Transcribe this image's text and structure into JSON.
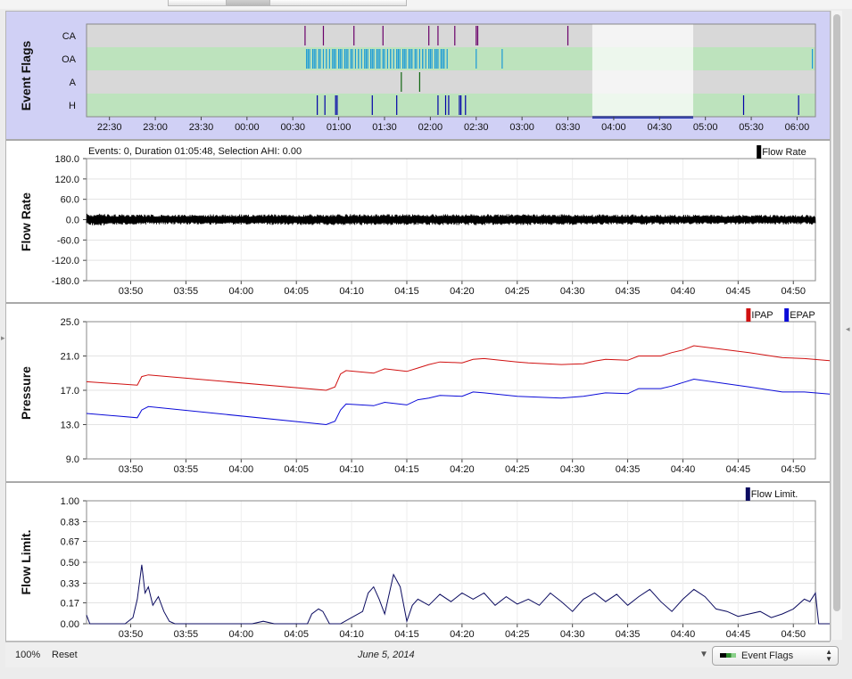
{
  "panels": {
    "event_flags": {
      "title": "Event Flags"
    },
    "flow_rate": {
      "title": "Flow Rate",
      "info": "Events: 0, Duration 01:05:48, Selection AHI: 0.00"
    },
    "pressure": {
      "title": "Pressure"
    },
    "flow_limit": {
      "title": "Flow Limit."
    }
  },
  "footer": {
    "zoom": "100%",
    "reset": "Reset",
    "date": "June 5, 2014",
    "selector": "Event Flags",
    "filter_icon": "funnel-icon"
  },
  "colors": {
    "ipap": "#d01010",
    "epap": "#0a0ad8",
    "flow": "#000000",
    "flowlimit": "#0b0b60",
    "ca_mark": "#6a006a",
    "oa_mark": "#1a9ad6",
    "a_mark": "#116611",
    "h_mark": "#0000a8",
    "event_bg": "#d0d0f5",
    "row_grey": "#d8d8d8",
    "row_green": "#bde3bd"
  },
  "chart_data": [
    {
      "type": "event-timeline",
      "rows": [
        "CA",
        "OA",
        "A",
        "H"
      ],
      "x_ticks": [
        "22:30",
        "23:00",
        "23:30",
        "00:00",
        "00:30",
        "01:00",
        "01:30",
        "02:00",
        "02:30",
        "03:00",
        "03:30",
        "04:00",
        "04:30",
        "05:00",
        "05:30",
        "06:00"
      ],
      "x_range": [
        "22:15",
        "06:12"
      ],
      "selection": [
        "03:46",
        "04:52"
      ],
      "events": {
        "CA": [
          "00:38",
          "00:50",
          "01:10",
          "01:29",
          "01:59",
          "02:05",
          "02:16",
          "02:30",
          "02:31",
          "03:30"
        ],
        "OA": {
          "dense_ranges": [
            [
              "00:39",
              "02:12"
            ]
          ],
          "isolated": [
            "02:30",
            "02:47",
            "06:10"
          ]
        },
        "A": [
          "01:41",
          "01:53"
        ],
        "H": [
          "00:46",
          "00:51",
          "00:58",
          "00:59",
          "01:22",
          "01:38",
          "02:05",
          "02:10",
          "02:12",
          "02:19",
          "02:20",
          "02:23",
          "05:25",
          "06:01"
        ]
      }
    },
    {
      "type": "line",
      "name": "Flow Rate",
      "legend": [
        "Flow Rate"
      ],
      "ylim": [
        -180,
        180
      ],
      "y_ticks": [
        "180.0",
        "120.0",
        "60.0",
        "0.0",
        "-60.0",
        "-120.0",
        "-180.0"
      ],
      "x_range": [
        "03:46",
        "04:52"
      ],
      "x_ticks": [
        "03:50",
        "03:55",
        "04:00",
        "04:05",
        "04:10",
        "04:15",
        "04:20",
        "04:25",
        "04:30",
        "04:35",
        "04:40",
        "04:45",
        "04:50"
      ],
      "envelope": {
        "upper": [
          [
            0,
            18
          ],
          [
            5,
            15
          ],
          [
            20,
            16
          ],
          [
            40,
            16
          ],
          [
            60,
            14
          ],
          [
            70,
            14
          ],
          [
            71,
            58
          ],
          [
            72,
            26
          ],
          [
            80,
            20
          ],
          [
            82,
            18
          ]
        ],
        "lower": [
          [
            0,
            -18
          ],
          [
            5,
            -14
          ],
          [
            20,
            -16
          ],
          [
            40,
            -16
          ],
          [
            60,
            -14
          ],
          [
            70,
            -14
          ],
          [
            71,
            -50
          ],
          [
            72,
            -26
          ],
          [
            80,
            -20
          ],
          [
            82,
            -19
          ]
        ]
      }
    },
    {
      "type": "line",
      "name": "Pressure",
      "legend": [
        "IPAP",
        "EPAP"
      ],
      "ylim": [
        9,
        25
      ],
      "y_ticks": [
        "25.0",
        "21.0",
        "17.0",
        "13.0",
        "9.0"
      ],
      "x_range": [
        "03:46",
        "04:52"
      ],
      "x_ticks": [
        "03:50",
        "03:55",
        "04:00",
        "04:05",
        "04:10",
        "04:15",
        "04:20",
        "04:25",
        "04:30",
        "04:35",
        "04:40",
        "04:45",
        "04:50"
      ],
      "series": [
        {
          "name": "IPAP",
          "points": [
            [
              0,
              18.0
            ],
            [
              4.6,
              17.6
            ],
            [
              5.0,
              18.6
            ],
            [
              5.6,
              18.8
            ],
            [
              21.7,
              17.0
            ],
            [
              22.5,
              17.4
            ],
            [
              23.0,
              18.9
            ],
            [
              23.5,
              19.3
            ],
            [
              26,
              19.0
            ],
            [
              27,
              19.5
            ],
            [
              29,
              19.2
            ],
            [
              30,
              19.6
            ],
            [
              31,
              20.0
            ],
            [
              32,
              20.3
            ],
            [
              34,
              20.2
            ],
            [
              35,
              20.6
            ],
            [
              36,
              20.7
            ],
            [
              39,
              20.3
            ],
            [
              40,
              20.2
            ],
            [
              43,
              20.0
            ],
            [
              45,
              20.1
            ],
            [
              46,
              20.4
            ],
            [
              47,
              20.6
            ],
            [
              49,
              20.5
            ],
            [
              50,
              21.0
            ],
            [
              52,
              21.0
            ],
            [
              53,
              21.4
            ],
            [
              54,
              21.7
            ],
            [
              55,
              22.2
            ],
            [
              60,
              21.4
            ],
            [
              63,
              20.8
            ],
            [
              65,
              20.7
            ],
            [
              82,
              18.9
            ]
          ]
        },
        {
          "name": "EPAP",
          "points": [
            [
              0,
              14.3
            ],
            [
              4.6,
              13.8
            ],
            [
              5.0,
              14.7
            ],
            [
              5.6,
              15.1
            ],
            [
              21.7,
              13.0
            ],
            [
              22.5,
              13.4
            ],
            [
              23.0,
              14.7
            ],
            [
              23.5,
              15.4
            ],
            [
              26,
              15.2
            ],
            [
              27,
              15.6
            ],
            [
              29,
              15.3
            ],
            [
              30,
              15.9
            ],
            [
              31,
              16.1
            ],
            [
              32,
              16.4
            ],
            [
              34,
              16.3
            ],
            [
              35,
              16.8
            ],
            [
              36,
              16.7
            ],
            [
              39,
              16.3
            ],
            [
              43,
              16.1
            ],
            [
              45,
              16.3
            ],
            [
              47,
              16.7
            ],
            [
              49,
              16.6
            ],
            [
              50,
              17.2
            ],
            [
              52,
              17.2
            ],
            [
              53,
              17.5
            ],
            [
              54,
              17.9
            ],
            [
              55,
              18.3
            ],
            [
              60,
              17.4
            ],
            [
              63,
              16.8
            ],
            [
              65,
              16.8
            ],
            [
              82,
              15.0
            ]
          ]
        }
      ]
    },
    {
      "type": "line",
      "name": "Flow Limit.",
      "legend": [
        "Flow Limit."
      ],
      "ylim": [
        0,
        1
      ],
      "y_ticks": [
        "1.00",
        "0.83",
        "0.67",
        "0.50",
        "0.33",
        "0.17",
        "0.00"
      ],
      "x_range": [
        "03:46",
        "04:52"
      ],
      "x_ticks": [
        "03:50",
        "03:55",
        "04:00",
        "04:05",
        "04:10",
        "04:15",
        "04:20",
        "04:25",
        "04:30",
        "04:35",
        "04:40",
        "04:45",
        "04:50"
      ],
      "series": [
        {
          "name": "Flow Limit.",
          "points": [
            [
              0,
              0.07
            ],
            [
              0.3,
              0.0
            ],
            [
              3.5,
              0.0
            ],
            [
              4.2,
              0.05
            ],
            [
              4.6,
              0.2
            ],
            [
              5.0,
              0.48
            ],
            [
              5.3,
              0.25
            ],
            [
              5.6,
              0.3
            ],
            [
              6.0,
              0.15
            ],
            [
              6.5,
              0.22
            ],
            [
              7.0,
              0.1
            ],
            [
              7.5,
              0.02
            ],
            [
              8.0,
              0.0
            ],
            [
              15,
              0.0
            ],
            [
              16,
              0.02
            ],
            [
              17,
              0.0
            ],
            [
              20.0,
              0.0
            ],
            [
              20.4,
              0.08
            ],
            [
              21.0,
              0.12
            ],
            [
              21.4,
              0.1
            ],
            [
              22,
              0.0
            ],
            [
              23.0,
              0.0
            ],
            [
              24.0,
              0.05
            ],
            [
              25.0,
              0.1
            ],
            [
              25.5,
              0.25
            ],
            [
              26.0,
              0.3
            ],
            [
              26.5,
              0.2
            ],
            [
              27.0,
              0.08
            ],
            [
              27.8,
              0.4
            ],
            [
              28.4,
              0.3
            ],
            [
              29.0,
              0.02
            ],
            [
              29.5,
              0.15
            ],
            [
              30.0,
              0.2
            ],
            [
              31.0,
              0.15
            ],
            [
              32.0,
              0.24
            ],
            [
              33.0,
              0.18
            ],
            [
              34.0,
              0.25
            ],
            [
              35.0,
              0.2
            ],
            [
              36.0,
              0.25
            ],
            [
              37.0,
              0.15
            ],
            [
              38.0,
              0.22
            ],
            [
              39.0,
              0.16
            ],
            [
              40.0,
              0.2
            ],
            [
              41.0,
              0.15
            ],
            [
              42.0,
              0.25
            ],
            [
              43.0,
              0.18
            ],
            [
              44.0,
              0.1
            ],
            [
              45.0,
              0.2
            ],
            [
              46.0,
              0.25
            ],
            [
              47.0,
              0.18
            ],
            [
              48.0,
              0.24
            ],
            [
              49.0,
              0.15
            ],
            [
              50.0,
              0.22
            ],
            [
              51.0,
              0.28
            ],
            [
              52.0,
              0.18
            ],
            [
              53.0,
              0.1
            ],
            [
              54.0,
              0.2
            ],
            [
              55.0,
              0.28
            ],
            [
              56.0,
              0.22
            ],
            [
              57.0,
              0.12
            ],
            [
              58.0,
              0.1
            ],
            [
              59.0,
              0.06
            ],
            [
              60.0,
              0.08
            ],
            [
              61.0,
              0.1
            ],
            [
              62.0,
              0.05
            ],
            [
              63.0,
              0.08
            ],
            [
              64.0,
              0.12
            ],
            [
              65.0,
              0.2
            ],
            [
              65.5,
              0.18
            ],
            [
              66.0,
              0.25
            ],
            [
              66.3,
              0.0
            ],
            [
              75.0,
              0.0
            ],
            [
              76.0,
              0.03
            ],
            [
              77.0,
              0.0
            ],
            [
              82.0,
              0.0
            ]
          ]
        }
      ]
    }
  ]
}
